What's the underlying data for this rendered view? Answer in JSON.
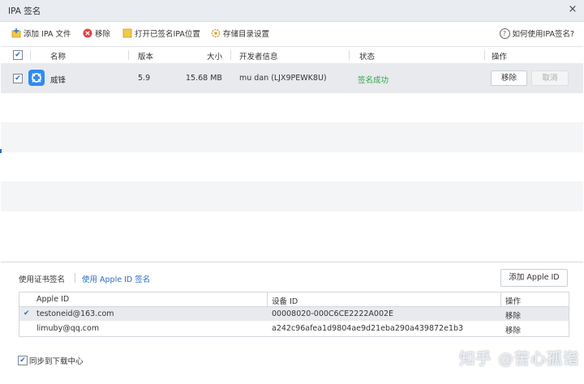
{
  "window": {
    "title": "IPA 签名",
    "close_glyph": "×"
  },
  "toolbar": {
    "add_ipa": "添加 IPA 文件",
    "remove": "移除",
    "open_folder": "打开已签名IPA位置",
    "storage": "存储目录设置",
    "help": "如何使用IPA签名?"
  },
  "table": {
    "headers": {
      "name": "名称",
      "version": "版本",
      "size": "大小",
      "developer": "开发者信息",
      "status": "状态",
      "action": "操作"
    },
    "rows": [
      {
        "checked": true,
        "name": "威锋",
        "version": "5.9",
        "size": "15.68 MB",
        "developer": "mu dan (LJX9PEWK8U)",
        "status": "签名成功",
        "btn_remove": "移除",
        "btn_cancel": "取消"
      }
    ]
  },
  "signing": {
    "tab_cert": "使用证书签名",
    "tab_appleid": "使用 Apple ID 签名",
    "add_appleid": "添加 Apple ID",
    "headers": {
      "apple_id": "Apple ID",
      "device_id": "设备 ID",
      "action": "操作"
    },
    "rows": [
      {
        "selected": true,
        "apple_id": "testoneid@163.com",
        "device_id": "00008020-000C6CE2222A002E",
        "action": "移除"
      },
      {
        "selected": false,
        "apple_id": "limuby@qq.com",
        "device_id": "a242c96afea1d9804ae9d21eba290a439872e1b3",
        "action": "移除"
      }
    ],
    "sync": "同步到下载中心"
  },
  "watermark": "知乎 @苦心孤诣",
  "colors": {
    "accent": "#2b6cc4",
    "success": "#2aa54a",
    "app_icon": "#2f8bf0",
    "remove_icon": "#e04444",
    "folder_icon": "#f3c94a"
  }
}
